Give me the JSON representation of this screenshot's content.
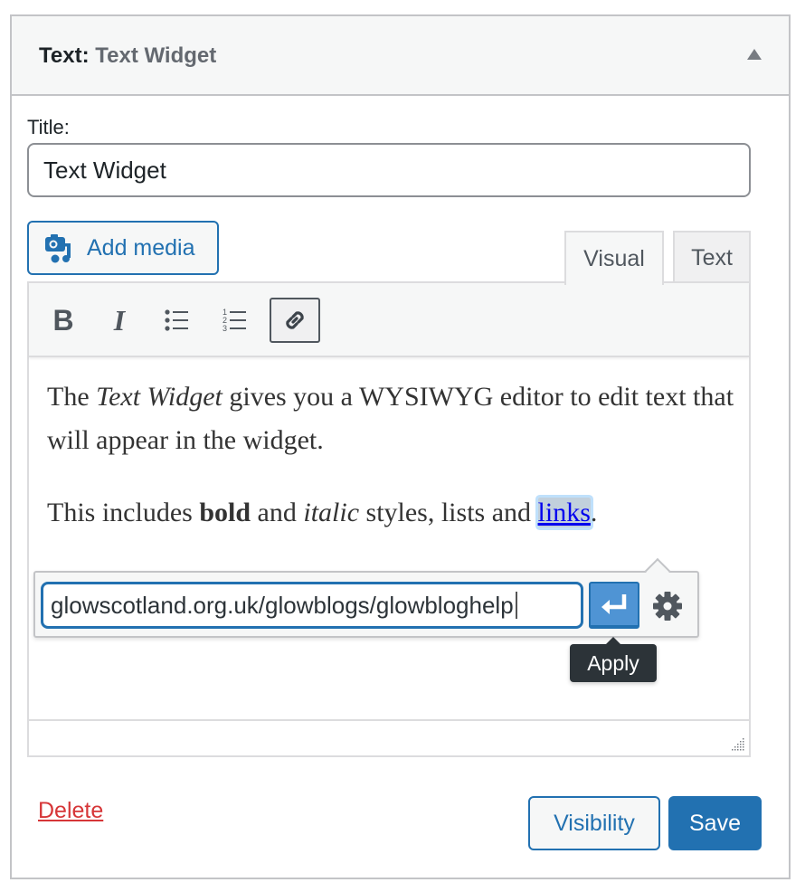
{
  "widget": {
    "type_label": "Text",
    "colon": ":",
    "instance_title": "Text Widget",
    "toggle_icon": "arrow-up-icon"
  },
  "form": {
    "title_label": "Title:",
    "title_value": "Text Widget"
  },
  "editor": {
    "add_media_label": "Add media",
    "tabs": [
      {
        "label": "Visual",
        "active": true
      },
      {
        "label": "Text",
        "active": false
      }
    ],
    "toolbar": [
      {
        "name": "bold",
        "icon": "bold-icon",
        "glyph": "B"
      },
      {
        "name": "italic",
        "icon": "italic-icon",
        "glyph": "I"
      },
      {
        "name": "bulleted-list",
        "icon": "bulleted-list-icon"
      },
      {
        "name": "numbered-list",
        "icon": "numbered-list-icon"
      },
      {
        "name": "link",
        "icon": "link-icon",
        "active": true
      }
    ],
    "content": {
      "p1": {
        "t1": "The ",
        "em": "Text Widget",
        "t2": " gives you a WYSIWYG editor to edit text that will appear in the widget."
      },
      "p2": {
        "t1": "This includes ",
        "strong": "bold",
        "t2": " and ",
        "em": "italic",
        "t3": " styles, lists and ",
        "link": "links",
        "t4": "."
      }
    }
  },
  "link_popup": {
    "url_value": "glowscotland.org.uk/glowblogs/glowbloghelp",
    "apply_tooltip": "Apply",
    "apply_icon": "enter-icon",
    "settings_icon": "gear-icon"
  },
  "actions": {
    "delete_label": "Delete",
    "visibility_label": "Visibility",
    "save_label": "Save"
  },
  "colors": {
    "primary": "#2271b1",
    "danger": "#d63638",
    "tooltip_bg": "#2c3338"
  }
}
